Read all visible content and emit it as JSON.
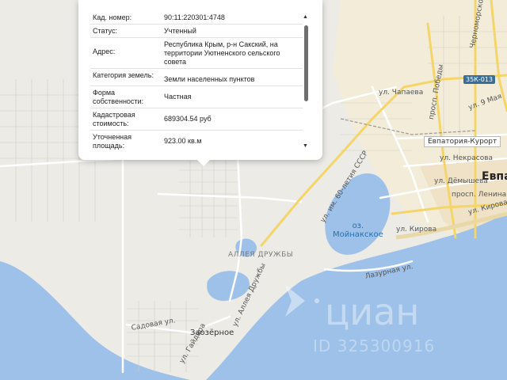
{
  "popup": {
    "rows": [
      {
        "key": "Кад. номер:",
        "value": "90:11:220301:4748"
      },
      {
        "key": "Статус:",
        "value": "Учтенный"
      },
      {
        "key": "Адрес:",
        "value": "Республика Крым, р-н Сакский, на территории Уютненского сельского совета"
      },
      {
        "key": "Категория земель:",
        "value": "Земли населенных пунктов"
      },
      {
        "key": "Форма собственности:",
        "value": "Частная"
      },
      {
        "key": "Кадастровая стоимость:",
        "value": "689304.54 руб"
      },
      {
        "key": "Уточненная площадь:",
        "value": "923.00 кв.м"
      }
    ]
  },
  "map": {
    "labels": {
      "chapaeva": "ул. Чапаева",
      "pobedy": "просп. Победы",
      "may9": "ул. 9 Мая",
      "nekrasova": "ул. Некрасова",
      "demysheva": "ул. Дёмышева",
      "lenina": "просп. Ленина",
      "kirova1": "ул. Кирова",
      "kirova2": "ул. Кирова",
      "sixty": "ул. им. 60-летия СССР",
      "alleya_cap": "АЛЛЕЯ ДРУЖБЫ",
      "alleya": "ул. Аллея Дружбы",
      "sadovaya": "Садовая ул.",
      "gaidara": "ул. Гайдара",
      "lazurnaya": "Лазурная ул.",
      "chernomorskoe": "Черноморское ш.",
      "route": "35К-013",
      "zaozernoe": "Заозёрное",
      "evpatoriya_city": "Евпа",
      "evpatoriya_kurort": "Евпатория-Курорт",
      "lake": "оз. Мойнакское",
      "lake_line1": "оз.",
      "lake_line2": "Мойнакское",
      "watermark_brand": "циан",
      "watermark_id": "ID 325300916"
    },
    "colors": {
      "sea": "#9dc1e8",
      "land": "#ecebe6",
      "road_yellow": "#f4d56a",
      "road_white": "#ffffff"
    }
  }
}
